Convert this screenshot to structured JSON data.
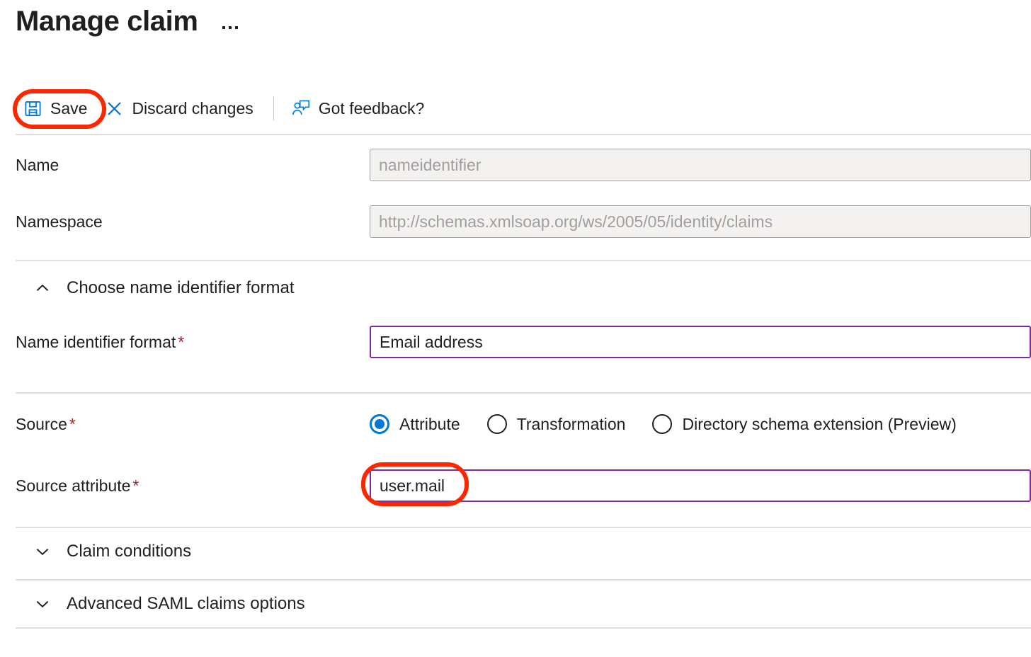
{
  "header": {
    "title": "Manage claim",
    "more_menu": {
      "name": "more-commands",
      "icon": "ellipsis-icon"
    }
  },
  "toolbar": {
    "items": [
      {
        "label": "Save",
        "icon": "save-floppy-icon",
        "highlighted": true
      },
      {
        "label": "Discard changes",
        "icon": "close-x-icon",
        "highlighted": false
      },
      {
        "label": "Got feedback?",
        "icon": "feedback-person-icon",
        "highlighted": false
      }
    ]
  },
  "form": {
    "name": {
      "label": "Name",
      "value": "nameidentifier",
      "state": "disabled"
    },
    "namespace": {
      "label": "Namespace",
      "value": "http://schemas.xmlsoap.org/ws/2005/05/identity/claims",
      "state": "disabled"
    },
    "name_identifier_section": {
      "title": "Choose name identifier format",
      "expanded": true,
      "chevron": "chevron-up-icon"
    },
    "name_identifier_format": {
      "label": "Name identifier format",
      "required_marker": "*",
      "value": "Email address",
      "state": "active"
    },
    "source": {
      "label": "Source",
      "required_marker": "*",
      "options": [
        {
          "label": "Attribute",
          "selected": true
        },
        {
          "label": "Transformation",
          "selected": false
        },
        {
          "label": "Directory schema extension (Preview)",
          "selected": false
        }
      ]
    },
    "source_attribute": {
      "label": "Source attribute",
      "required_marker": "*",
      "value": "user.mail",
      "state": "active",
      "highlighted": true
    },
    "claim_conditions_section": {
      "title": "Claim conditions",
      "expanded": false,
      "chevron": "chevron-down-icon"
    },
    "advanced_saml_section": {
      "title": "Advanced SAML claims options",
      "expanded": false,
      "chevron": "chevron-down-icon"
    }
  },
  "colors": {
    "accent_blue": "#0078d4",
    "field_focus_purple": "#8228a0",
    "required_red": "#a4262c",
    "annotation_red": "#fa2800",
    "divider_gray": "#e1dfdd",
    "disabled_bg": "#f3f2f1",
    "disabled_text": "#a19f9d"
  }
}
